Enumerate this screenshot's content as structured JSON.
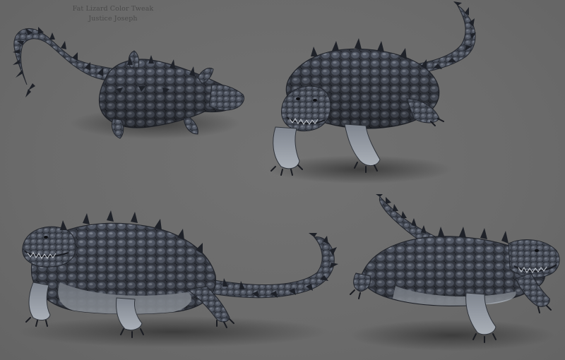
{
  "caption": {
    "title": "Fat Lizard Color Tweak",
    "author": "Justice Joseph"
  },
  "colors": {
    "background": "#6d6d6d",
    "skin_dark": "#2c3038",
    "skin_mid": "#4a4f5a",
    "skin_light": "#8c929c",
    "belly": "#a4a8ae",
    "shadow": "#3a3a3a"
  },
  "views": [
    {
      "id": "top"
    },
    {
      "id": "front"
    },
    {
      "id": "side"
    },
    {
      "id": "three-quarter"
    }
  ]
}
